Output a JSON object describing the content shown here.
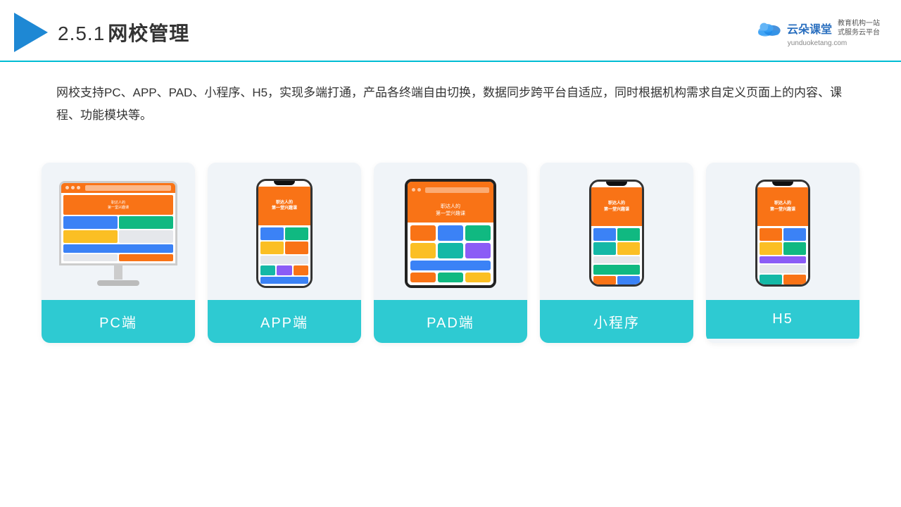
{
  "header": {
    "title_num": "2.5.1",
    "title_text": "网校管理",
    "logo_main": "云朵课堂",
    "logo_url": "yunduoketang.com",
    "logo_tagline": "教育机构一站\n式服务云平台"
  },
  "description": {
    "text": "网校支持PC、APP、PAD、小程序、H5，实现多端打通，产品各终端自由切换，数据同步跨平台自适应，同时根据机构需求自定义页面上的内容、课程、功能模块等。"
  },
  "cards": [
    {
      "id": "pc",
      "label": "PC端",
      "type": "pc"
    },
    {
      "id": "app",
      "label": "APP端",
      "type": "phone"
    },
    {
      "id": "pad",
      "label": "PAD端",
      "type": "pad"
    },
    {
      "id": "mini",
      "label": "小程序",
      "type": "phone"
    },
    {
      "id": "h5",
      "label": "H5",
      "type": "phone"
    }
  ],
  "colors": {
    "accent": "#2ecad2",
    "header_line": "#00bcd4",
    "card_bg": "#f0f4f8"
  }
}
